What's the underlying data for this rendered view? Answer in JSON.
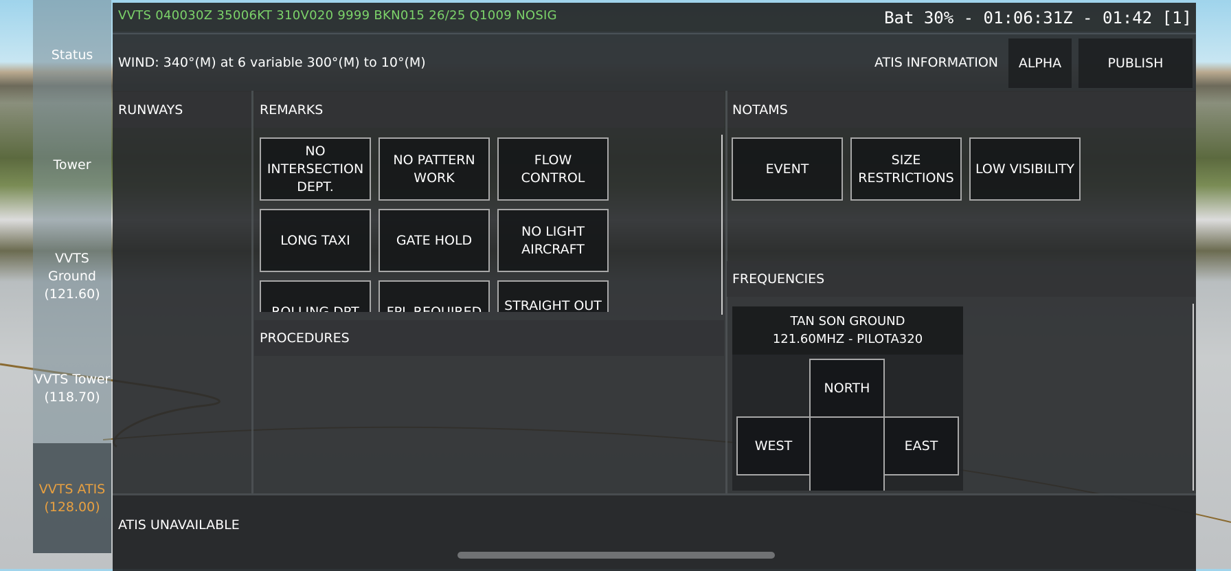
{
  "sidebar": {
    "items": [
      {
        "label": "Status"
      },
      {
        "label": "Tower"
      },
      {
        "label": "VVTS Ground (121.60)"
      },
      {
        "label": "VVTS Tower (118.70)"
      },
      {
        "label": "VVTS ATIS (128.00)",
        "active": true
      }
    ]
  },
  "topbar": {
    "metar": "VVTS 040030Z 35006KT 310V020 9999 BKN015 26/25 Q1009 NOSIG",
    "status": "Bat 30% - 01:06:31Z - 01:42 [1]"
  },
  "windbar": {
    "wind": "WIND: 340°(M) at 6 variable 300°(M) to 10°(M)",
    "atis_information_label": "ATIS INFORMATION",
    "atis_letter": "ALPHA",
    "publish_label": "PUBLISH"
  },
  "sections": {
    "runways": "RUNWAYS",
    "remarks": "REMARKS",
    "notams": "NOTAMS",
    "procedures": "PROCEDURES",
    "frequencies": "FREQUENCIES"
  },
  "remarks": [
    "NO INTERSECTION DEPT.",
    "NO PATTERN WORK",
    "FLOW CONTROL",
    "LONG TAXI",
    "GATE HOLD",
    "NO LIGHT AIRCRAFT",
    "ROLLING DPT",
    "FPL REQUIRED",
    "STRAIGHT OUT"
  ],
  "notams": [
    "EVENT",
    "SIZE RESTRICTIONS",
    "LOW VISIBILITY"
  ],
  "frequency": {
    "name": "TAN SON GROUND",
    "detail": "121.60MHZ - PILOTA320",
    "north": "NORTH",
    "west": "WEST",
    "east": "EAST"
  },
  "bottom": {
    "status": "ATIS UNAVAILABLE"
  },
  "colors": {
    "metar": "#7cd36a",
    "active_sidebar": "#e8a040"
  }
}
